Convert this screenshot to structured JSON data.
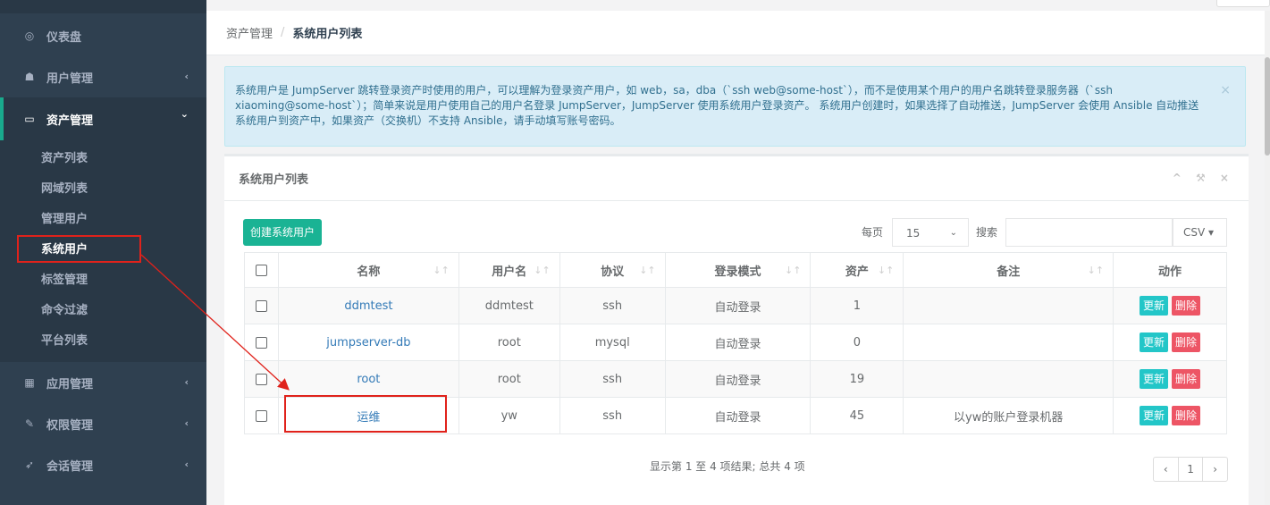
{
  "sidebar": {
    "items": [
      {
        "icon": "dashboard-icon",
        "glyph": "◎",
        "label": "仪表盘",
        "chevron": ""
      },
      {
        "icon": "users-icon",
        "glyph": "☗",
        "label": "用户管理",
        "chevron": "‹"
      },
      {
        "icon": "inbox-icon",
        "glyph": "▭",
        "label": "资产管理",
        "chevron": "⌄"
      }
    ],
    "asset_submenu": [
      "资产列表",
      "网域列表",
      "管理用户",
      "系统用户",
      "标签管理",
      "命令过滤",
      "平台列表"
    ],
    "bottom_items": [
      {
        "icon": "grid-icon",
        "glyph": "▦",
        "label": "应用管理",
        "chevron": "‹"
      },
      {
        "icon": "edit-icon",
        "glyph": "✎",
        "label": "权限管理",
        "chevron": "‹"
      },
      {
        "icon": "rocket-icon",
        "glyph": "➶",
        "label": "会话管理",
        "chevron": "‹"
      }
    ]
  },
  "breadcrumb": {
    "parent": "资产管理",
    "separator": "/",
    "current": "系统用户列表"
  },
  "alert": {
    "text": "系统用户是 JumpServer 跳转登录资产时使用的用户，可以理解为登录资产用户，如 web，sa，dba（`ssh web@some-host`），而不是使用某个用户的用户名跳转登录服务器（`ssh xiaoming@some-host`）；简单来说是用户使用自己的用户名登录 JumpServer，JumpServer 使用系统用户登录资产。 系统用户创建时，如果选择了自动推送，JumpServer 会使用 Ansible 自动推送系统用户到资产中，如果资产（交换机）不支持 Ansible，请手动填写账号密码。",
    "close": "×"
  },
  "panel": {
    "title": "系统用户列表",
    "tools": "^ ⚒ ×",
    "create_label": "创建系统用户",
    "per_page_label": "每页",
    "per_page_value": "15",
    "search_label": "搜索",
    "search_value": "",
    "csv_label": "CSV ▾"
  },
  "table": {
    "headers": [
      "名称",
      "用户名",
      "协议",
      "登录模式",
      "资产",
      "备注",
      "动作"
    ],
    "rows": [
      {
        "name": "ddmtest",
        "username": "ddmtest",
        "protocol": "ssh",
        "mode": "自动登录",
        "assets": "1",
        "comment": ""
      },
      {
        "name": "jumpserver-db",
        "username": "root",
        "protocol": "mysql",
        "mode": "自动登录",
        "assets": "0",
        "comment": ""
      },
      {
        "name": "root",
        "username": "root",
        "protocol": "ssh",
        "mode": "自动登录",
        "assets": "19",
        "comment": ""
      },
      {
        "name": "运维",
        "username": "yw",
        "protocol": "ssh",
        "mode": "自动登录",
        "assets": "45",
        "comment": "以yw的账户登录机器"
      }
    ],
    "update_label": "更新",
    "delete_label": "删除"
  },
  "footer": {
    "info": "显示第 1 至 4 项结果; 总共 4 项",
    "pager_prev": "‹",
    "pager_current": "1",
    "pager_next": "›"
  },
  "colors": {
    "sidebar": "#2f4050",
    "primary": "#1ab394",
    "info": "#23c6c8",
    "danger": "#ed5565",
    "annotation": "#e0221b"
  }
}
